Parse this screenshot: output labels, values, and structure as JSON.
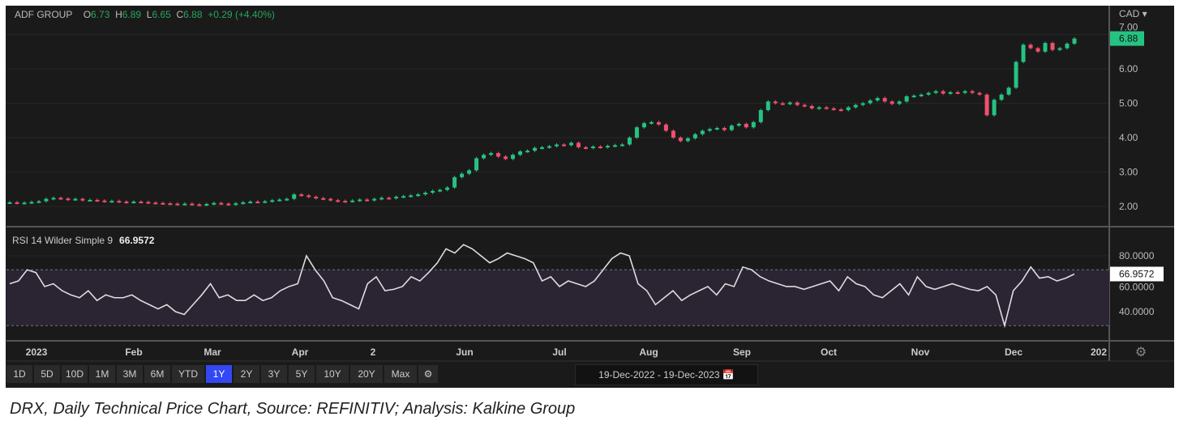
{
  "header": {
    "symbol": "ADF GROUP",
    "o_label": "O",
    "open": "6.73",
    "h_label": "H",
    "high": "6.89",
    "l_label": "L",
    "low": "6.65",
    "c_label": "C",
    "close": "6.88",
    "change": "+0.29 (+4.40%)"
  },
  "currency": "CAD ▾",
  "rsi": {
    "label": "RSI 14 Wilder Simple 9",
    "value": "66.9572"
  },
  "price_axis": [
    "7.00",
    "6.00",
    "5.00",
    "4.00",
    "3.00",
    "2.00"
  ],
  "last_price": "6.88",
  "rsi_axis": [
    "80.0000",
    "60.0000",
    "40.0000"
  ],
  "time_axis": [
    "2023",
    "Feb",
    "Mar",
    "Apr",
    "2",
    "Jun",
    "Jul",
    "Aug",
    "Sep",
    "Oct",
    "Nov",
    "Dec",
    "202"
  ],
  "range_buttons": [
    "1D",
    "5D",
    "10D",
    "1M",
    "3M",
    "6M",
    "YTD",
    "1Y",
    "2Y",
    "3Y",
    "5Y",
    "10Y",
    "20Y",
    "Max"
  ],
  "active_range": "1Y",
  "date_range": "19-Dec-2022  -  19-Dec-2023",
  "caption": "DRX, Daily Technical Price Chart, Source: REFINITIV; Analysis: Kalkine Group",
  "colors": {
    "up": "#26c281",
    "down": "#f0506e",
    "bg": "#1a1a1a",
    "active": "#3347f5"
  },
  "chart_data": {
    "type": "candlestick",
    "title": "ADF GROUP",
    "x_range": [
      "19-Dec-2022",
      "19-Dec-2023"
    ],
    "ylim": [
      1.5,
      7.5
    ],
    "closes": [
      2.12,
      2.1,
      2.11,
      2.13,
      2.15,
      2.22,
      2.25,
      2.23,
      2.2,
      2.22,
      2.18,
      2.19,
      2.17,
      2.15,
      2.16,
      2.14,
      2.12,
      2.14,
      2.13,
      2.11,
      2.1,
      2.09,
      2.08,
      2.07,
      2.08,
      2.06,
      2.05,
      2.07,
      2.1,
      2.08,
      2.06,
      2.09,
      2.12,
      2.14,
      2.13,
      2.15,
      2.18,
      2.2,
      2.22,
      2.35,
      2.32,
      2.28,
      2.24,
      2.22,
      2.18,
      2.16,
      2.15,
      2.17,
      2.2,
      2.18,
      2.22,
      2.25,
      2.24,
      2.28,
      2.3,
      2.32,
      2.35,
      2.4,
      2.45,
      2.48,
      2.55,
      2.85,
      2.95,
      3.05,
      3.4,
      3.5,
      3.55,
      3.45,
      3.38,
      3.5,
      3.6,
      3.62,
      3.7,
      3.72,
      3.75,
      3.8,
      3.78,
      3.85,
      3.72,
      3.7,
      3.74,
      3.72,
      3.76,
      3.78,
      3.8,
      4.0,
      4.3,
      4.42,
      4.45,
      4.38,
      4.2,
      4.0,
      3.9,
      3.98,
      4.1,
      4.2,
      4.25,
      4.28,
      4.22,
      4.35,
      4.4,
      4.3,
      4.45,
      4.8,
      5.05,
      5.0,
      4.98,
      5.02,
      4.95,
      4.92,
      4.85,
      4.88,
      4.85,
      4.82,
      4.8,
      4.88,
      4.95,
      5.0,
      5.08,
      5.15,
      5.05,
      4.98,
      5.05,
      5.2,
      5.22,
      5.25,
      5.3,
      5.35,
      5.28,
      5.32,
      5.3,
      5.35,
      5.3,
      5.25,
      4.65,
      5.1,
      5.25,
      5.45,
      6.2,
      6.7,
      6.6,
      6.5,
      6.75,
      6.55,
      6.6,
      6.73,
      6.88
    ],
    "rsi_series": {
      "name": "RSI 14",
      "ylim": [
        20,
        95
      ],
      "bands": [
        30,
        70
      ],
      "values": [
        60,
        62,
        70,
        68,
        58,
        60,
        55,
        52,
        50,
        55,
        48,
        52,
        50,
        50,
        52,
        48,
        45,
        42,
        45,
        40,
        38,
        45,
        52,
        60,
        50,
        52,
        48,
        48,
        52,
        48,
        50,
        55,
        58,
        60,
        80,
        70,
        62,
        50,
        48,
        45,
        42,
        60,
        65,
        55,
        56,
        58,
        65,
        62,
        68,
        75,
        85,
        82,
        88,
        85,
        80,
        75,
        78,
        82,
        80,
        78,
        75,
        62,
        65,
        58,
        62,
        60,
        58,
        62,
        70,
        78,
        82,
        80,
        60,
        55,
        45,
        50,
        55,
        48,
        52,
        55,
        58,
        52,
        60,
        58,
        72,
        70,
        65,
        62,
        60,
        58,
        58,
        56,
        58,
        60,
        62,
        55,
        65,
        60,
        58,
        52,
        50,
        55,
        60,
        52,
        65,
        58,
        56,
        58,
        60,
        58,
        56,
        55,
        58,
        52,
        30,
        55,
        62,
        72,
        64,
        65,
        62,
        64,
        66.9572
      ]
    }
  }
}
